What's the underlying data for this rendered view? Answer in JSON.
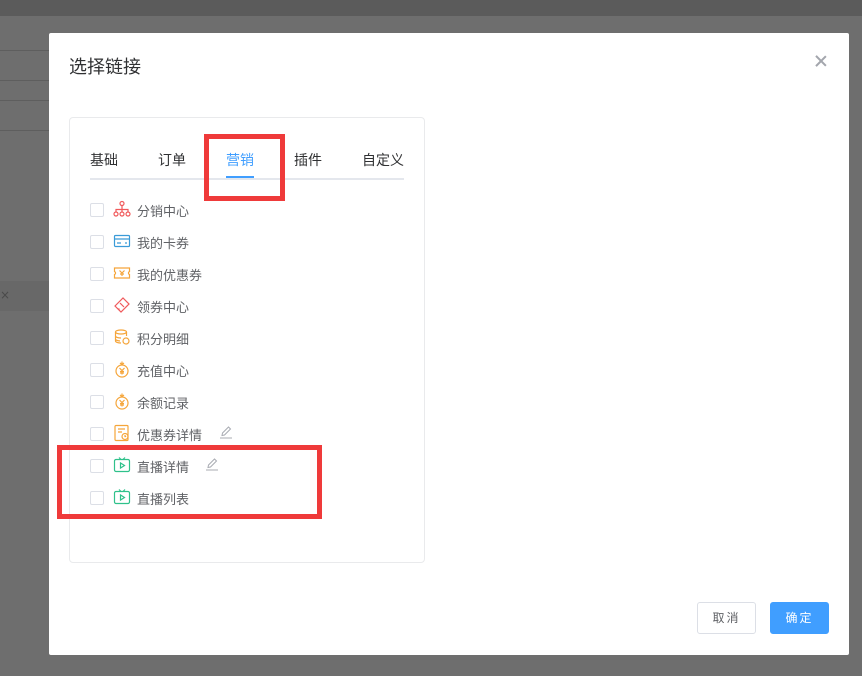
{
  "dialog": {
    "title": "选择链接",
    "cancel_label": "取消",
    "confirm_label": "确定"
  },
  "tabs": [
    {
      "label": "基础",
      "active": false
    },
    {
      "label": "订单",
      "active": false
    },
    {
      "label": "营销",
      "active": true
    },
    {
      "label": "插件",
      "active": false
    },
    {
      "label": "自定义",
      "active": false
    }
  ],
  "items": [
    {
      "label": "分销中心",
      "icon": "distribution-network-icon",
      "checked": false,
      "editable": false
    },
    {
      "label": "我的卡券",
      "icon": "card-icon",
      "checked": false,
      "editable": false
    },
    {
      "label": "我的优惠券",
      "icon": "ticket-icon",
      "checked": false,
      "editable": false
    },
    {
      "label": "领券中心",
      "icon": "coupon-tag-icon",
      "checked": false,
      "editable": false
    },
    {
      "label": "积分明细",
      "icon": "coin-stack-icon",
      "checked": false,
      "editable": false
    },
    {
      "label": "充值中心",
      "icon": "yuan-coin-icon",
      "checked": false,
      "editable": false
    },
    {
      "label": "余额记录",
      "icon": "yuan-coin-icon",
      "checked": false,
      "editable": false
    },
    {
      "label": "优惠券详情",
      "icon": "coupon-detail-icon",
      "checked": false,
      "editable": true
    },
    {
      "label": "直播详情",
      "icon": "live-tv-icon",
      "checked": false,
      "editable": true
    },
    {
      "label": "直播列表",
      "icon": "live-tv-icon",
      "checked": false,
      "editable": false
    }
  ],
  "colors": {
    "accent": "#409eff",
    "highlight": "#ef3a3a",
    "icon_red": "#f0595b",
    "icon_blue": "#3a9bd8",
    "icon_orange": "#f5a53a",
    "icon_green": "#2fc18b"
  }
}
